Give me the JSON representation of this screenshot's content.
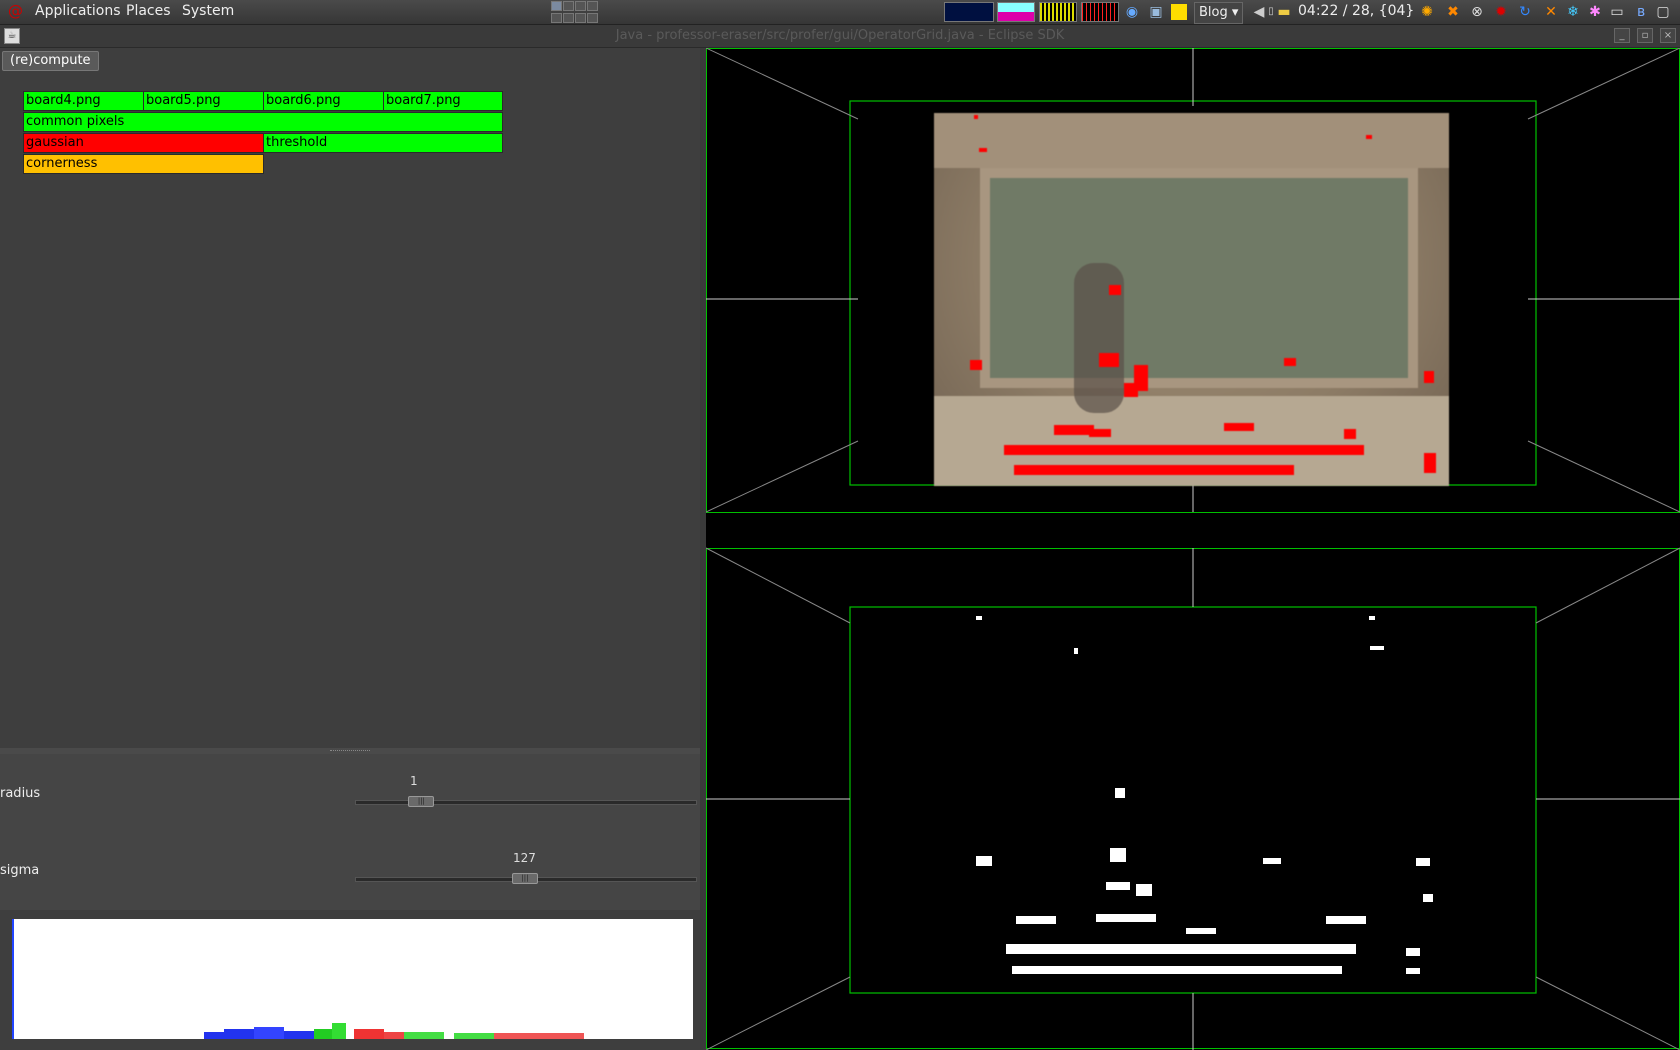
{
  "panel": {
    "menu_applications": "Applications",
    "menu_places": "Places",
    "menu_system": "System",
    "blog_label": "Blog",
    "clock": "04:22 / 28, {04}",
    "tray_icons": [
      "globe-icon",
      "network-icon",
      "notes-icon",
      "volume-icon",
      "folder-icon",
      "sun-icon",
      "crossed-tools-icon",
      "x-circle-icon",
      "gear-red-icon",
      "refresh-icon",
      "bird-icon",
      "snowflake-icon",
      "star-icon",
      "display-icon",
      "bluetooth-icon",
      "monitor-icon"
    ]
  },
  "window": {
    "title": "Java - professor-eraser/src/profer/gui/OperatorGrid.java - Eclipse SDK"
  },
  "toolbar": {
    "recompute_label": "(re)compute"
  },
  "grid": {
    "row1": [
      "board4.png",
      "board5.png",
      "board6.png",
      "board7.png"
    ],
    "common": "common pixels",
    "gaussian": "gaussian",
    "threshold": "threshold",
    "cornerness": "cornerness"
  },
  "sliders": {
    "radius": {
      "label": "radius",
      "value": "1",
      "fraction": 0.17
    },
    "sigma": {
      "label": "sigma",
      "value": "127",
      "fraction": 0.5
    }
  },
  "colors": {
    "ok": "#00ff00",
    "error": "#ff0000",
    "pending": "#ffc000",
    "frame": "#00cc00"
  }
}
